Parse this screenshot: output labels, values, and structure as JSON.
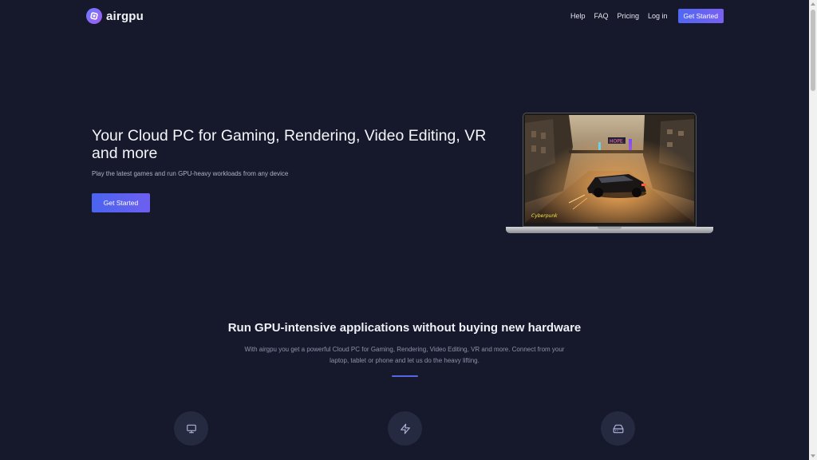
{
  "nav": {
    "brand": "airgpu",
    "links": [
      "Help",
      "FAQ",
      "Pricing",
      "Log in"
    ],
    "cta": "Get Started"
  },
  "hero": {
    "title": "Your Cloud PC for Gaming, Rendering, Video Editing, VR and more",
    "subtitle": "Play the latest games and run GPU-heavy workloads from any device",
    "button": "Get Started",
    "image_icon": "laptop-with-game-screenshot"
  },
  "section": {
    "title": "Run GPU-intensive applications without buying new hardware",
    "description": "With airgpu you get a powerful Cloud PC for Gaming, Rendering, Video Editing, VR and more. Connect from your laptop, tablet or phone and let us do the heavy lifting.",
    "feature_icons": [
      "monitor-icon",
      "lightning-icon",
      "hard-drive-icon"
    ]
  },
  "colors": {
    "background": "#16182b",
    "accent": "#5468e6",
    "accent_gradient_end": "#7a5ff2",
    "icon_circle": "#262a40"
  }
}
